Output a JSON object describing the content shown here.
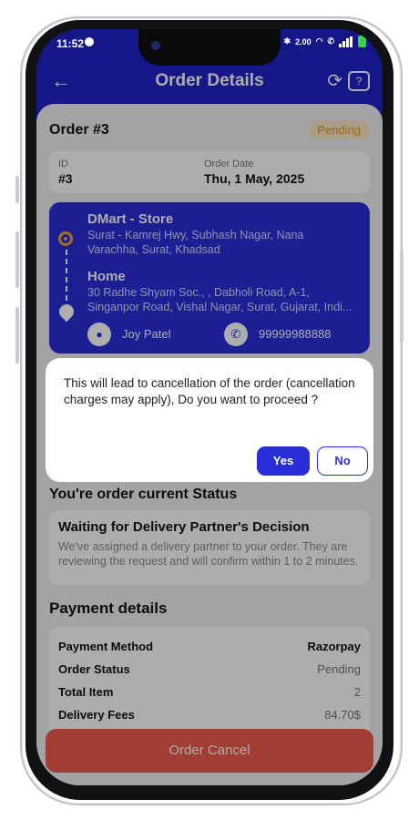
{
  "status_bar": {
    "time": "11:52",
    "speed": "2.00"
  },
  "header": {
    "title": "Order Details",
    "back_icon": "←",
    "refresh_icon": "⟳",
    "help_icon": "?"
  },
  "order": {
    "heading": "Order #3",
    "status_chip": "Pending",
    "id_label": "ID",
    "id_value": "#3",
    "date_label": "Order Date",
    "date_value": "Thu, 1 May, 2025"
  },
  "addresses": {
    "store_title": "DMart - Store",
    "store_line1": "Surat - Kamrej Hwy, Subhash Nagar, Nana",
    "store_line2": "Varachha, Surat, Khadsad",
    "home_title": "Home",
    "home_line1": "30 Radhe Shyam Soc., , Dabholi Road, A-1,",
    "home_line2": "Singanpor Road, Vishal Nagar, Surat, Gujarat, Indi...",
    "customer_name": "Joy Patel",
    "customer_phone": "99999988888"
  },
  "current_status": {
    "section_title": "You're order current Status",
    "heading": "Waiting for Delivery Partner's Decision",
    "description": "We've assigned a delivery partner to your order. They are reviewing the request and will confirm within 1 to 2 minutes."
  },
  "payment": {
    "section_title": "Payment details",
    "rows": [
      {
        "label": "Payment Method",
        "value": "Razorpay"
      },
      {
        "label": "Order Status",
        "value": "Pending"
      },
      {
        "label": "Total Item",
        "value": "2"
      },
      {
        "label": "Delivery Fees",
        "value": "84.70$"
      }
    ]
  },
  "cancel_button": "Order Cancel",
  "dialog": {
    "message": "This will lead to cancellation of the order (cancellation charges may apply), Do you want to proceed ?",
    "yes_label": "Yes",
    "no_label": "No"
  },
  "colors": {
    "primary": "#2a2ed9",
    "danger": "#ee5b4b",
    "pending": "#e99b1d"
  }
}
